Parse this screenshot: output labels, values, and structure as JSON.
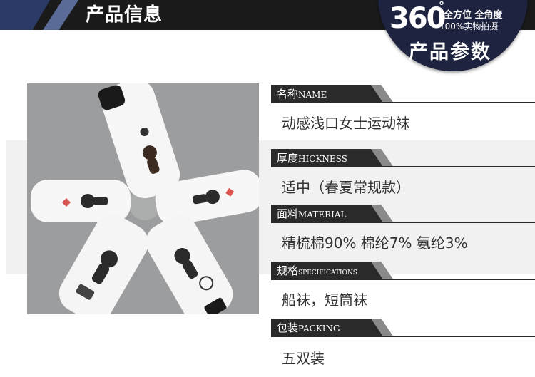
{
  "header": {
    "title": "产品信息"
  },
  "badge": {
    "number": "360",
    "degree_mark": "°",
    "tagline_1": "全方位 全角度",
    "tagline_2": "100%实物拍摄",
    "subtitle": "产品参数"
  },
  "specs": [
    {
      "label_cn": "名称",
      "label_en": "NAME",
      "value": "动感浅口女士运动袜"
    },
    {
      "label_cn": "厚度",
      "label_en": "HICKNESS",
      "value": "适中（春夏常规款）"
    },
    {
      "label_cn": "面料",
      "label_en": "MATERIAL",
      "value": "精梳棉90%  棉纶7%  氨纶3%"
    },
    {
      "label_cn": "规格",
      "label_en": "SPECIFICATIONS",
      "value": "船袜，短筒袜"
    },
    {
      "label_cn": "包装",
      "label_en": "PACKING",
      "value": "五双装"
    }
  ],
  "colors": {
    "header_bar": "#1a1a1a",
    "badge": "#1e2340",
    "label_bar": "#2a2a2a",
    "value_text": "#333333"
  }
}
